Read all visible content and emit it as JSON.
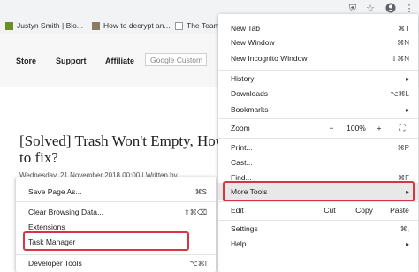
{
  "browser": {
    "bookmarks": [
      "Justyn Smith | Blo...",
      "How to decrypt an...",
      "The Team"
    ],
    "toolbar_icons": [
      "extension-icon",
      "star-icon",
      "profile-icon",
      "kebab-menu-icon"
    ]
  },
  "site": {
    "nav": [
      "Store",
      "Support",
      "Affiliate"
    ],
    "search_placeholder": "Google Custom",
    "article_title": "[Solved] Trash Won't Empty, How to fix?",
    "article_meta": "Wednesday, 21 November 2018 00:00 | Written by"
  },
  "main_menu": {
    "new_tab": "New Tab",
    "new_tab_sc": "⌘T",
    "new_window": "New Window",
    "new_window_sc": "⌘N",
    "new_incognito": "New Incognito Window",
    "new_incognito_sc": "⇧⌘N",
    "history": "History",
    "downloads": "Downloads",
    "downloads_sc": "⌥⌘L",
    "bookmarks": "Bookmarks",
    "zoom": "Zoom",
    "zoom_minus": "−",
    "zoom_value": "100%",
    "zoom_plus": "+",
    "print": "Print...",
    "print_sc": "⌘P",
    "cast": "Cast...",
    "find": "Find...",
    "find_sc": "⌘F",
    "more_tools": "More Tools",
    "edit": "Edit",
    "cut": "Cut",
    "copy": "Copy",
    "paste": "Paste",
    "settings": "Settings",
    "settings_sc": "⌘,",
    "help": "Help"
  },
  "sub_menu": {
    "save_page": "Save Page As...",
    "save_page_sc": "⌘S",
    "clear_data": "Clear Browsing Data...",
    "clear_data_sc": "⇧⌘⌫",
    "extensions": "Extensions",
    "task_manager": "Task Manager",
    "dev_tools": "Developer Tools",
    "dev_tools_sc": "⌥⌘I"
  },
  "colors": {
    "highlight_box": "#d93444",
    "menu_hover": "#e8e8e8"
  }
}
